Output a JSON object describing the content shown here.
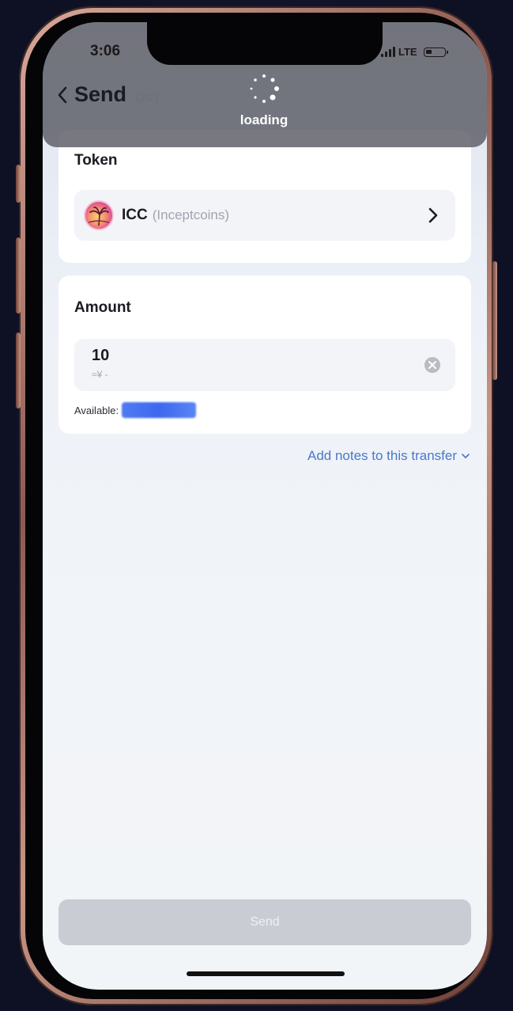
{
  "status_bar": {
    "time": "3:06",
    "network": "LTE"
  },
  "nav": {
    "title": "Send",
    "step": "(2/2)"
  },
  "loading": {
    "label": "loading"
  },
  "token_section": {
    "title": "Token",
    "symbol": "ICC",
    "name": "(Inceptcoins)"
  },
  "amount_section": {
    "title": "Amount",
    "value": "10",
    "fiat_estimate": "≈¥ -",
    "available_label": "Available:"
  },
  "notes": {
    "label": "Add notes to this transfer"
  },
  "send_button": {
    "label": "Send",
    "state": "disabled"
  },
  "colors": {
    "link": "#4a78c8",
    "send_disabled": "#c9ccd3",
    "overlay": "#5a5c64",
    "redacted": "#3d68ee"
  }
}
